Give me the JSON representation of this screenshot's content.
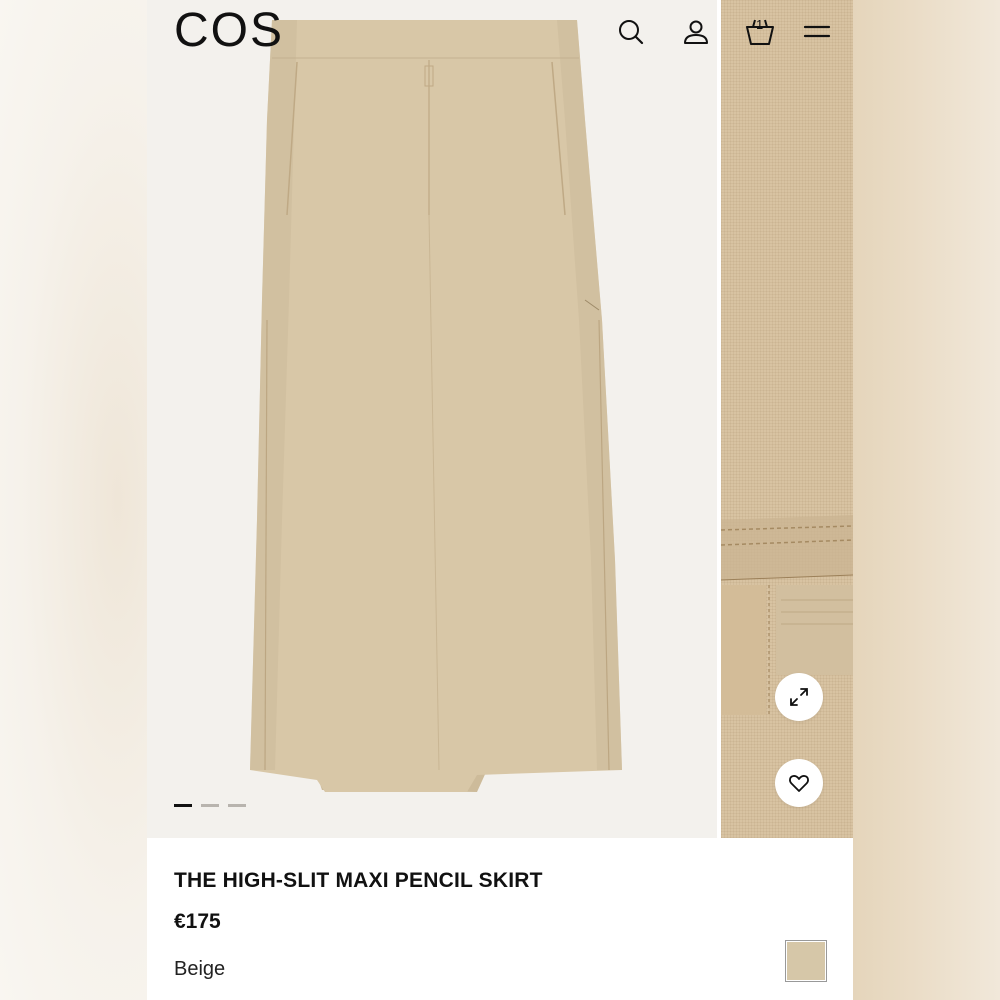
{
  "header": {
    "logo": "COS",
    "bag_count": "1"
  },
  "icons": {
    "search": "search-icon",
    "account": "user-icon",
    "bag": "shopping-bag-icon",
    "menu": "hamburger-menu-icon",
    "expand": "expand-icon",
    "wishlist": "heart-icon"
  },
  "gallery": {
    "image_count": 3,
    "active_index": 0
  },
  "product": {
    "title": "THE HIGH-SLIT MAXI PENCIL SKIRT",
    "price": "€175",
    "color_name": "Beige",
    "swatch_color": "#d6c7a8"
  },
  "colors": {
    "fabric": "#d9c8a9",
    "text": "#111111",
    "background": "#ffffff"
  }
}
